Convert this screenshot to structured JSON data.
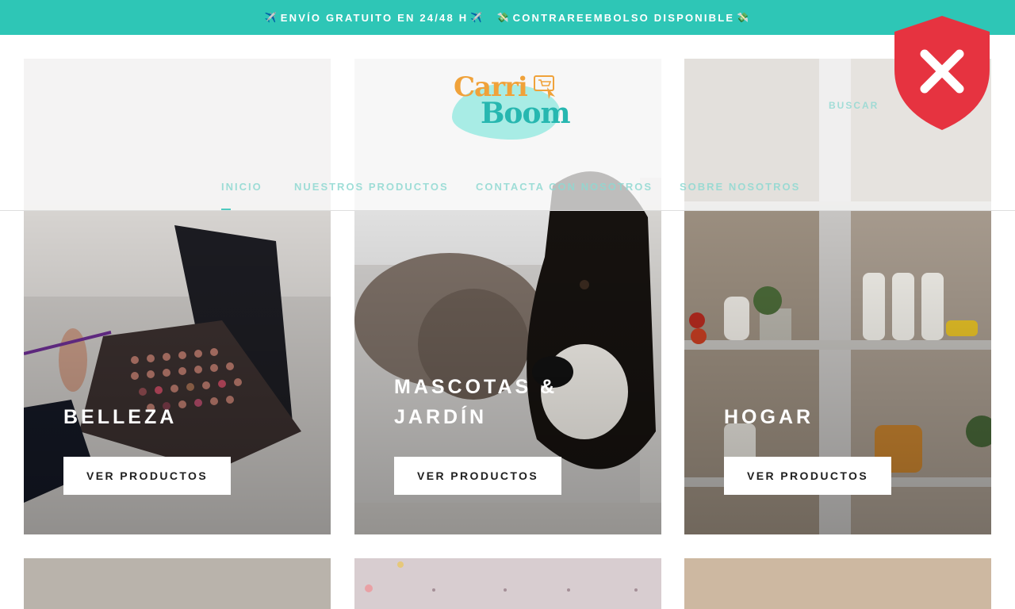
{
  "announcement": {
    "text1": "ENVÍO GRATUITO EN 24/48 H",
    "text2": "CONTRAREEMBOLSO DISPONIBLE",
    "emoji_plane": "✈️",
    "emoji_money": "💸"
  },
  "brand": {
    "word1": "Carri",
    "word2": "Boom"
  },
  "nav": {
    "items": [
      {
        "label": "INICIO"
      },
      {
        "label": "NUESTROS PRODUCTOS"
      },
      {
        "label": "CONTACTA CON NOSOTROS"
      },
      {
        "label": "SOBRE NOSOTROS"
      }
    ],
    "search_label": "BUSCAR"
  },
  "categories": [
    {
      "title": "BELLEZA",
      "button": "VER PRODUCTOS"
    },
    {
      "title_line1": "MASCOTAS &",
      "title_line2": "JARDÍN",
      "button": "VER PRODUCTOS"
    },
    {
      "title": "HOGAR",
      "button": "VER PRODUCTOS"
    }
  ],
  "colors": {
    "announcement_bg": "#2ec6b6",
    "brand_orange": "#f0a23a",
    "brand_teal": "#27b7b0",
    "blocker_red": "#e63340"
  },
  "overlay_icon": "shield-close-icon"
}
